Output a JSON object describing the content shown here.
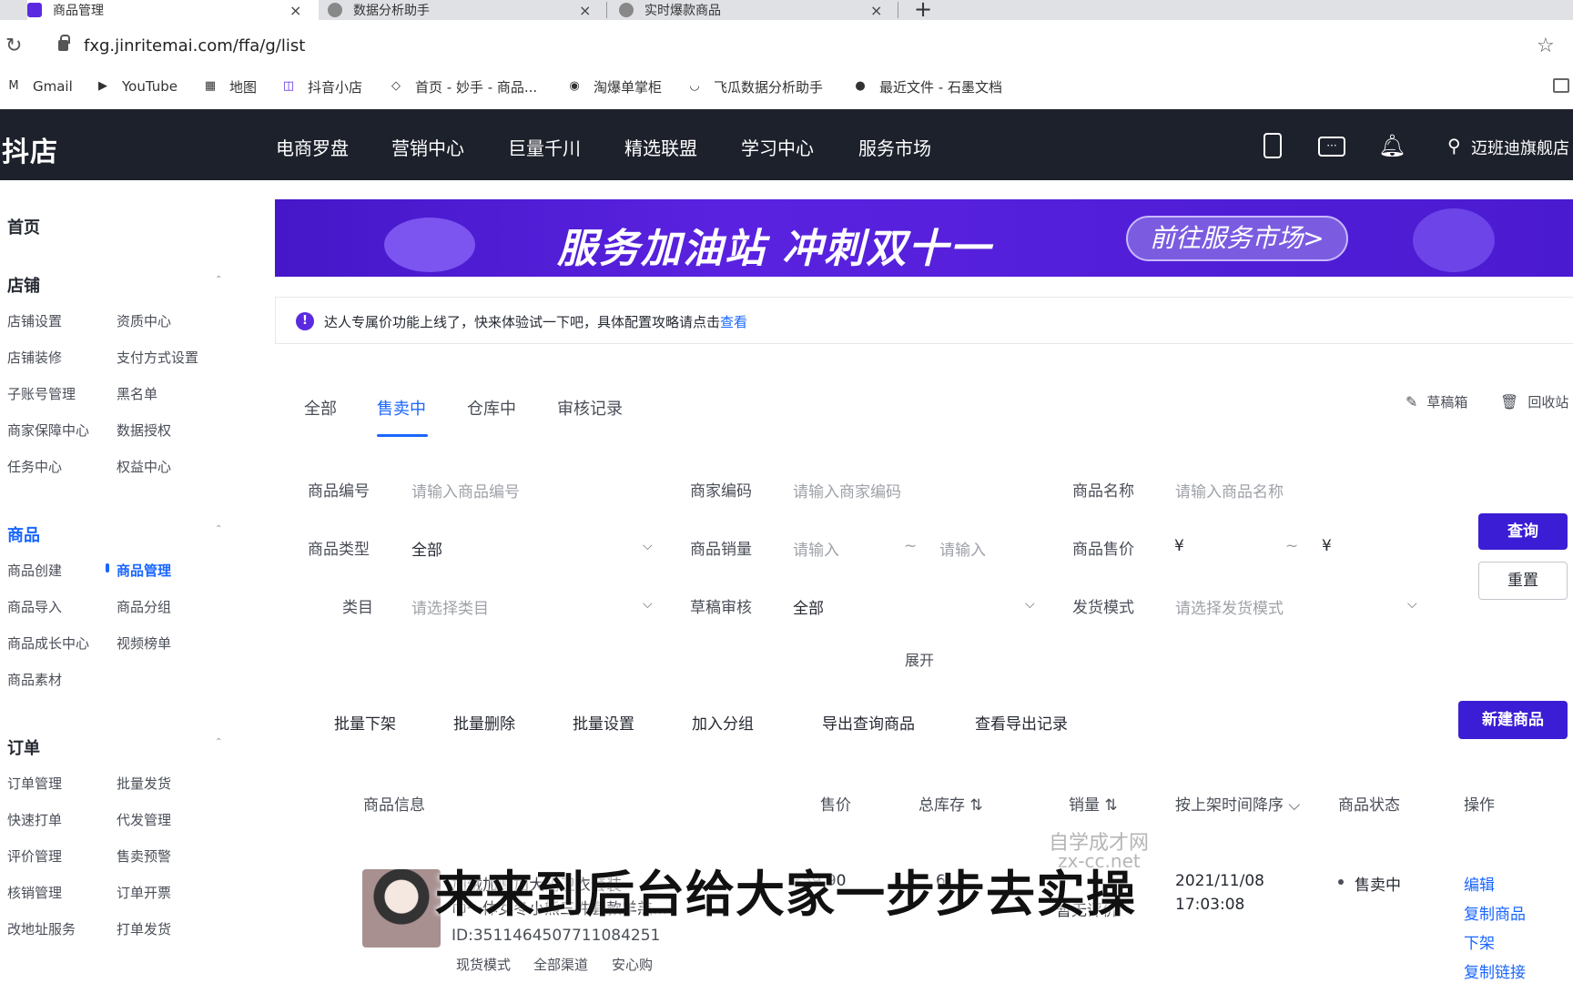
{
  "browser": {
    "tabs": [
      {
        "title": "商品管理",
        "close": "×"
      },
      {
        "title": "数据分析助手",
        "close": "×"
      },
      {
        "title": "实时爆款商品",
        "close": "×"
      }
    ],
    "new_tab": "+",
    "url": "fxg.jinritemai.com/ffa/g/list",
    "bookmarks": [
      "Gmail",
      "YouTube",
      "地图",
      "抖音小店",
      "首页 - 妙手 - 商品...",
      "淘爆单掌柜",
      "飞瓜数据分析助手",
      "最近文件 - 石墨文档"
    ]
  },
  "topnav": {
    "logo": "抖店",
    "items": [
      "电商罗盘",
      "营销中心",
      "巨量千川",
      "精选联盟",
      "学习中心",
      "服务市场"
    ],
    "username": "迈班迪旗舰店"
  },
  "sidebar": {
    "home": "首页",
    "groups": [
      {
        "title": "店铺",
        "items": [
          "店铺设置",
          "资质中心",
          "店铺装修",
          "支付方式设置",
          "子账号管理",
          "黑名单",
          "商家保障中心",
          "数据授权",
          "任务中心",
          "权益中心"
        ]
      },
      {
        "title": "商品",
        "items": [
          "商品创建",
          "商品管理",
          "商品导入",
          "商品分组",
          "商品成长中心",
          "视频榜单",
          "商品素材"
        ]
      },
      {
        "title": "订单",
        "items": [
          "订单管理",
          "批量发货",
          "快速打单",
          "代发管理",
          "评价管理",
          "售卖预警",
          "核销管理",
          "订单开票",
          "改地址服务",
          "打单发货"
        ]
      }
    ]
  },
  "banner": {
    "title": "服务加油站 冲刺双十一",
    "button": "前往服务市场>"
  },
  "notice": {
    "text": "达人专属价功能上线了，快来体验试一下吧，具体配置攻略请点击",
    "link": "查看"
  },
  "tabs": [
    "全部",
    "售卖中",
    "仓库中",
    "审核记录"
  ],
  "utils": {
    "drafts": "草稿箱",
    "recycle": "回收站"
  },
  "filters": {
    "product_id": {
      "label": "商品编号",
      "placeholder": "请输入商品编号"
    },
    "merchant_code": {
      "label": "商家编码",
      "placeholder": "请输入商家编码"
    },
    "product_name": {
      "label": "商品名称",
      "placeholder": "请输入商品名称"
    },
    "product_type": {
      "label": "商品类型",
      "value": "全部"
    },
    "sales": {
      "label": "商品销量",
      "min": "请输入",
      "sep": "~",
      "max": "请输入"
    },
    "price": {
      "label": "商品售价",
      "min": "¥",
      "sep": "~",
      "max": "¥"
    },
    "category": {
      "label": "类目",
      "placeholder": "请选择类目"
    },
    "draft_review": {
      "label": "草稿审核",
      "value": "全部"
    },
    "ship_mode": {
      "label": "发货模式",
      "placeholder": "请选择发货模式"
    },
    "query": "查询",
    "reset": "重置",
    "expand": "展开"
  },
  "batch": [
    "批量下架",
    "批量删除",
    "批量设置",
    "加入分组",
    "导出查询商品",
    "查看导出记录"
  ],
  "new_product": "新建商品",
  "table": {
    "headers": [
      "商品信息",
      "售价",
      "总库存 ⇅",
      "销量 ⇅",
      "按上架时间降序 ⌵",
      "商品状态",
      "操作"
    ],
    "row": {
      "name_line1": "加绒加厚加大码卫衣套装",
      "name_line2": "巾一体女冬小熊三件套款羊羔...",
      "id": "ID:3511464507711084251",
      "tags": [
        "现货模式",
        "全部渠道",
        "安心购"
      ],
      "price": "¥59.90",
      "stock": "6",
      "sales": "暂无评价",
      "date": "2021/11/08",
      "time": "17:03:08",
      "status": "售卖中",
      "ops": [
        "编辑",
        "复制商品",
        "下架",
        "复制链接"
      ]
    }
  },
  "overlay": {
    "watermark1": "自学成才网",
    "watermark2": "zx-cc.net",
    "subtitle": "来来到后台给大家一步步去实操"
  }
}
